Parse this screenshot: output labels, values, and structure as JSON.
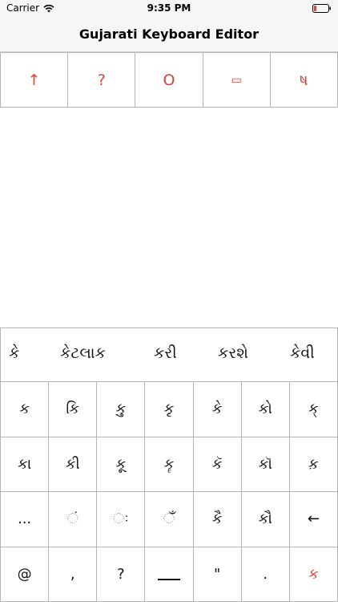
{
  "status": {
    "carrier": "Carrier",
    "time": "9:35 PM"
  },
  "nav": {
    "title": "Gujarati Keyboard Editor"
  },
  "tools": [
    {
      "label": "↑"
    },
    {
      "label": "?"
    },
    {
      "label": "O"
    },
    {
      "label": "▭"
    },
    {
      "label": "ષ"
    }
  ],
  "suggestions": [
    "કે",
    "કેટલાક",
    "કરી",
    "કરશે",
    "કેવી"
  ],
  "keys": {
    "row1": [
      "ક",
      "કિ",
      "કુ",
      "કૃ",
      "કે",
      "કો",
      "ક્"
    ],
    "row2": [
      "કા",
      "કી",
      "કૂ",
      "કૄ",
      "કૅ",
      "કૉ",
      "ક઼"
    ],
    "row3": [
      "...",
      "ં",
      "ઃ",
      "ઁ",
      "કૈ",
      "કૌ",
      "←"
    ],
    "row4": [
      "@",
      ",",
      "?",
      "",
      "\"",
      ".",
      "ક"
    ]
  },
  "colors": {
    "accent": "#d9443b",
    "border": "#b5b5b5",
    "bar_background": "#f6f6f6"
  }
}
